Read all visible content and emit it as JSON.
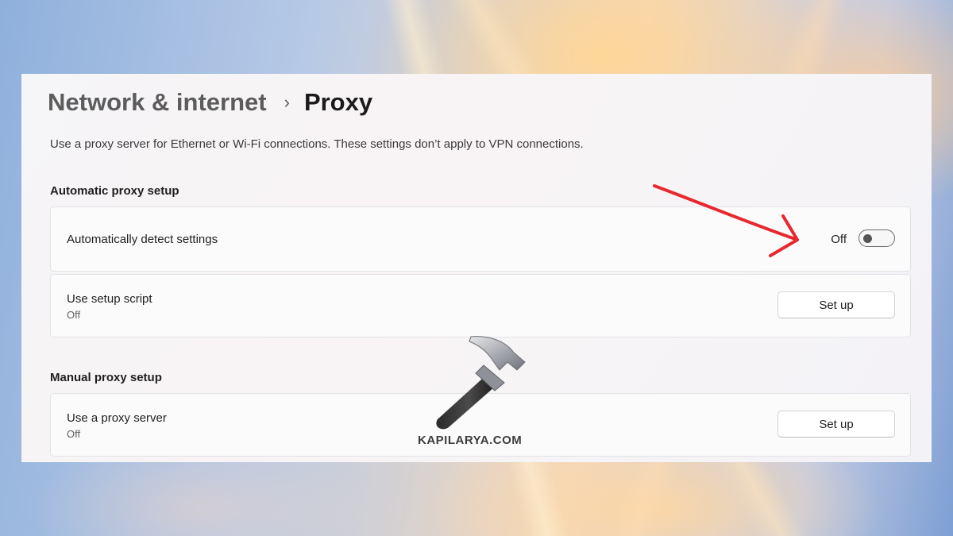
{
  "breadcrumb": {
    "parent": "Network & internet",
    "separator": "›",
    "current": "Proxy"
  },
  "description": "Use a proxy server for Ethernet or Wi-Fi connections. These settings don’t apply to VPN connections.",
  "automatic_section": {
    "heading": "Automatic proxy setup",
    "detect_settings": {
      "label": "Automatically detect settings",
      "state_label": "Off",
      "enabled": false
    },
    "setup_script": {
      "label": "Use setup script",
      "status": "Off",
      "button_label": "Set up"
    }
  },
  "manual_section": {
    "heading": "Manual proxy setup",
    "proxy_server": {
      "label": "Use a proxy server",
      "status": "Off",
      "button_label": "Set up"
    }
  },
  "watermark": {
    "text": "KAPILARYA.COM"
  },
  "colors": {
    "annotation_arrow": "#e8282e"
  },
  "icons": {
    "breadcrumb_separator": "chevron-right-icon",
    "watermark_logo": "hammer-icon",
    "annotation": "red-arrow"
  }
}
